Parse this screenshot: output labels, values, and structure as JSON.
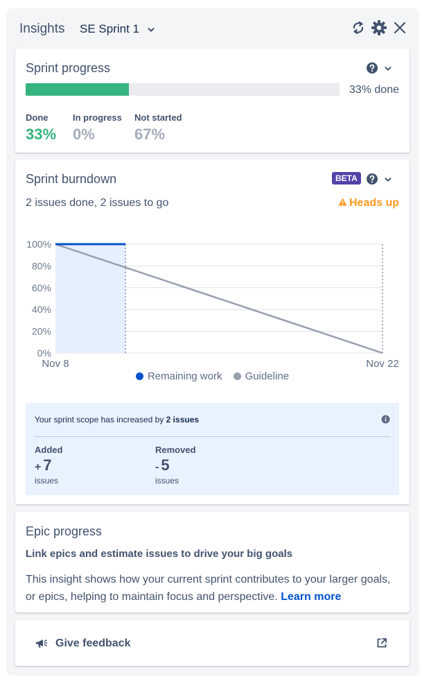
{
  "header": {
    "title": "Insights",
    "sprint_selector": "SE Sprint 1"
  },
  "sprint_progress": {
    "title": "Sprint progress",
    "percent_done": 33,
    "done_text": "33% done",
    "stats": [
      {
        "label": "Done",
        "value": "33%",
        "color": "#36b37e"
      },
      {
        "label": "In progress",
        "value": "0%",
        "color": "#a5adba"
      },
      {
        "label": "Not started",
        "value": "67%",
        "color": "#a5adba"
      }
    ]
  },
  "sprint_burndown": {
    "title": "Sprint burndown",
    "badge": "BETA",
    "summary": "2 issues done, 2 issues to go",
    "warning": "Heads up",
    "legend": {
      "remaining": "Remaining work",
      "guideline": "Guideline"
    },
    "scope_message_prefix": "Your sprint scope has increased by ",
    "scope_message_bold": "2 issues",
    "added_label": "Added",
    "added_sign": "+",
    "added_value": "7",
    "removed_label": "Removed",
    "removed_sign": "-",
    "removed_value": "5",
    "unit": "issues"
  },
  "chart_data": {
    "type": "line",
    "x_labels": [
      "Nov 8",
      "Nov 22"
    ],
    "y_ticks": [
      "0%",
      "20%",
      "40%",
      "60%",
      "80%",
      "100%"
    ],
    "ylim": [
      0,
      100
    ],
    "grid": true,
    "legend_position": "bottom",
    "series": [
      {
        "name": "Remaining work",
        "color": "#0052cc",
        "x": [
          "Nov 8",
          "Nov 11"
        ],
        "y": [
          100,
          100
        ]
      },
      {
        "name": "Guideline",
        "color": "#97a0af",
        "x": [
          "Nov 8",
          "Nov 22"
        ],
        "y": [
          100,
          0
        ]
      }
    ],
    "sprint_days": 14,
    "elapsed_days": 3
  },
  "epic_progress": {
    "title": "Epic progress",
    "subtitle": "Link epics and estimate issues to drive your big goals",
    "body": "This insight shows how your current sprint contributes to your larger goals, or epics, helping to maintain focus and perspective.",
    "link": "Learn more"
  },
  "feedback": {
    "label": "Give feedback"
  },
  "colors": {
    "accent": "#0052cc",
    "done": "#36b37e",
    "beta": "#5243aa",
    "warning": "#ff991f"
  }
}
